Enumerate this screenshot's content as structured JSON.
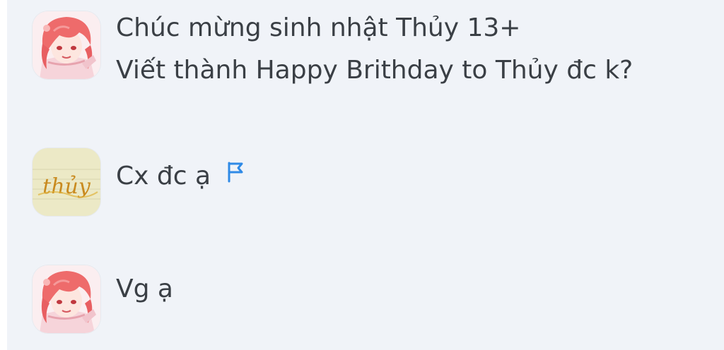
{
  "comments": [
    {
      "avatar_icon": "anime-girl-avatar",
      "lines": [
        "Chúc mừng sinh nhật Thủy 13+",
        "Viết thành Happy Brithday to Thủy đc k?"
      ]
    },
    {
      "avatar_icon": "handwritten-name-avatar",
      "avatar_signature": "thủy",
      "text": "Cx đc ạ",
      "flag_icon": "report-flag-icon"
    },
    {
      "avatar_icon": "anime-girl-avatar",
      "text": "Vg ạ"
    }
  ],
  "colors": {
    "background": "#f0f3f8",
    "text": "#3a3f45",
    "flag": "#2f8ae6"
  }
}
